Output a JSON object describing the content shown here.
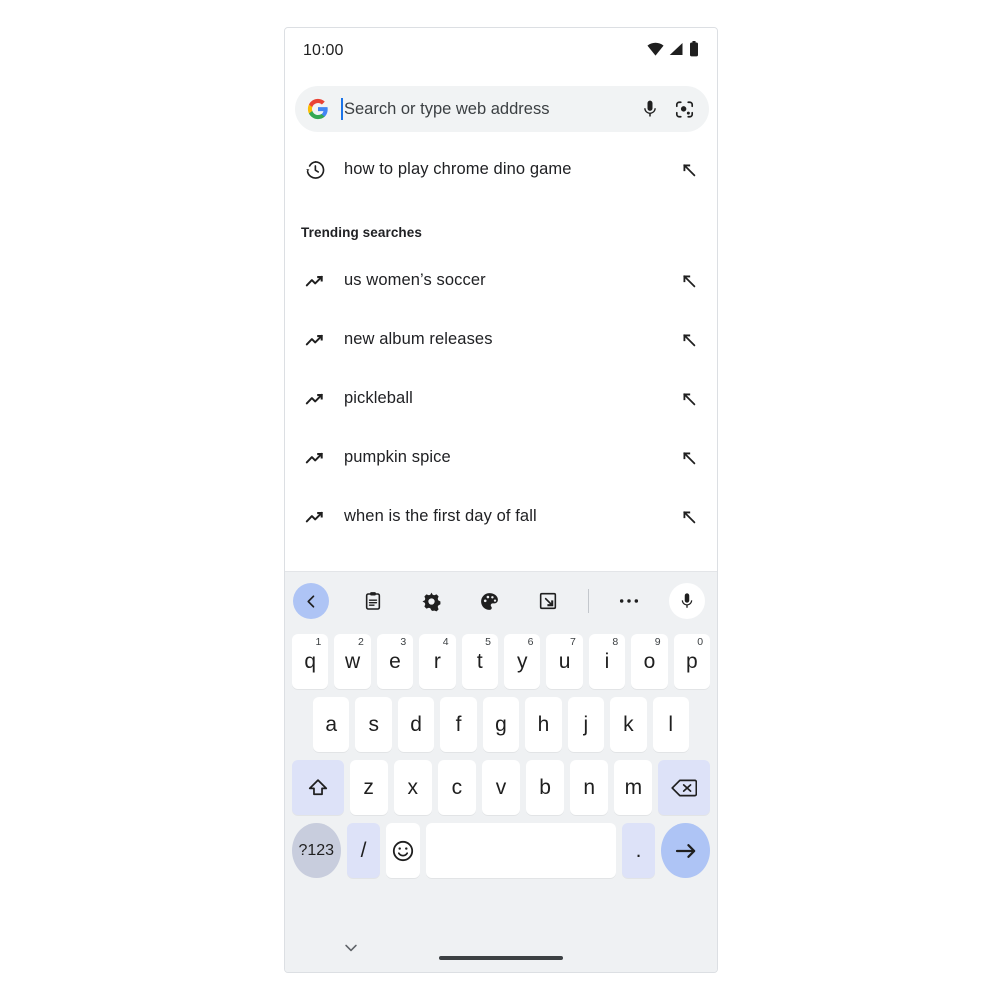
{
  "status_bar": {
    "time": "10:00",
    "icons": [
      "wifi-icon",
      "cellular-signal-icon",
      "battery-icon"
    ]
  },
  "omnibox": {
    "logo": "google-g-logo",
    "placeholder": "Search or type web address",
    "value": "",
    "caret_color": "#1a73e8",
    "mic_icon": "microphone-icon",
    "lens_icon": "google-lens-icon",
    "background": "#f1f3f4"
  },
  "suggestions": {
    "history": [
      {
        "text": "how to play chrome dino game",
        "lead_icon": "history-clock-icon",
        "append_icon": "append-arrow-icon"
      }
    ],
    "section_header": "Trending searches",
    "trending": [
      {
        "text": "us women’s soccer",
        "lead_icon": "trending-up-icon",
        "append_icon": "append-arrow-icon"
      },
      {
        "text": "new album releases",
        "lead_icon": "trending-up-icon",
        "append_icon": "append-arrow-icon"
      },
      {
        "text": "pickleball",
        "lead_icon": "trending-up-icon",
        "append_icon": "append-arrow-icon"
      },
      {
        "text": "pumpkin spice",
        "lead_icon": "trending-up-icon",
        "append_icon": "append-arrow-icon"
      },
      {
        "text": "when is the first day of fall",
        "lead_icon": "trending-up-icon",
        "append_icon": "append-arrow-icon"
      }
    ]
  },
  "keyboard": {
    "toolbar": {
      "back": "back-chevron-icon",
      "clipboard": "clipboard-icon",
      "settings": "gear-icon",
      "theme": "palette-icon",
      "resize": "resize-keyboard-icon",
      "overflow": "more-options-icon",
      "voice": "microphone-icon",
      "accent": "#aec4f5"
    },
    "row1": [
      {
        "key": "q",
        "num": "1"
      },
      {
        "key": "w",
        "num": "2"
      },
      {
        "key": "e",
        "num": "3"
      },
      {
        "key": "r",
        "num": "4"
      },
      {
        "key": "t",
        "num": "5"
      },
      {
        "key": "y",
        "num": "6"
      },
      {
        "key": "u",
        "num": "7"
      },
      {
        "key": "i",
        "num": "8"
      },
      {
        "key": "o",
        "num": "9"
      },
      {
        "key": "p",
        "num": "0"
      }
    ],
    "row2": [
      {
        "key": "a"
      },
      {
        "key": "s"
      },
      {
        "key": "d"
      },
      {
        "key": "f"
      },
      {
        "key": "g"
      },
      {
        "key": "h"
      },
      {
        "key": "j"
      },
      {
        "key": "k"
      },
      {
        "key": "l"
      }
    ],
    "row3": {
      "shift": "shift-icon",
      "letters": [
        {
          "key": "z"
        },
        {
          "key": "x"
        },
        {
          "key": "c"
        },
        {
          "key": "v"
        },
        {
          "key": "b"
        },
        {
          "key": "n"
        },
        {
          "key": "m"
        }
      ],
      "backspace": "backspace-icon"
    },
    "row4": {
      "symbols": "?123",
      "slash": "/",
      "emoji": "emoji-icon",
      "space": "",
      "period": ".",
      "enter": "enter-arrow-icon"
    }
  },
  "navigation": {
    "dismiss": "chevron-down-icon",
    "home_bar": "gesture-home-bar"
  }
}
